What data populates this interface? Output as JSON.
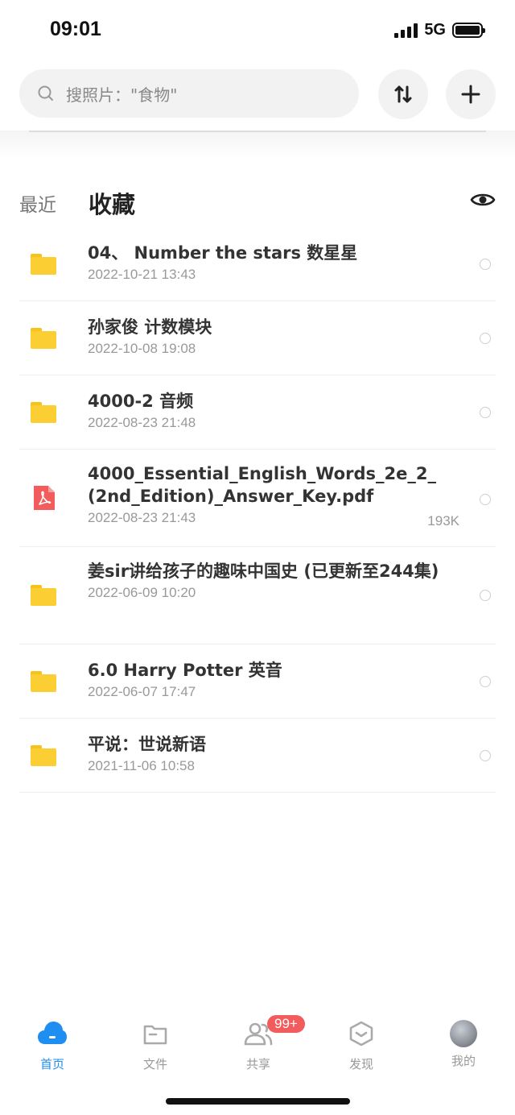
{
  "status_bar": {
    "time": "09:01",
    "network": "5G"
  },
  "search": {
    "placeholder": "搜照片：\"食物\""
  },
  "tabs": {
    "recent": "最近",
    "favorites": "收藏"
  },
  "files": [
    {
      "name": "04、 Number the stars  数星星",
      "date": "2022-10-21 13:43",
      "size": "",
      "type": "folder"
    },
    {
      "name": "孙家俊 计数模块",
      "date": "2022-10-08 19:08",
      "size": "",
      "type": "folder"
    },
    {
      "name": "4000-2 音频",
      "date": "2022-08-23 21:48",
      "size": "",
      "type": "folder"
    },
    {
      "name": "4000_Essential_English_Words_2e_2_(2nd_Edition)_Answer_Key.pdf",
      "date": "2022-08-23 21:43",
      "size": "193K",
      "type": "pdf"
    },
    {
      "name": "姜sir讲给孩子的趣味中国史 (已更新至244集)",
      "date": "2022-06-09 10:20",
      "size": "",
      "type": "folder"
    },
    {
      "name": "6.0 Harry Potter 英音",
      "date": "2022-06-07 17:47",
      "size": "",
      "type": "folder"
    },
    {
      "name": "平说：世说新语",
      "date": "2021-11-06 10:58",
      "size": "",
      "type": "folder"
    }
  ],
  "nav": {
    "home": "首页",
    "files": "文件",
    "share": "共享",
    "discover": "发现",
    "mine": "我的",
    "share_badge": "99+"
  },
  "colors": {
    "accent": "#1f8ef1",
    "folder": "#fbcf33",
    "pdf": "#f25c5c",
    "badge": "#f25c5c"
  }
}
